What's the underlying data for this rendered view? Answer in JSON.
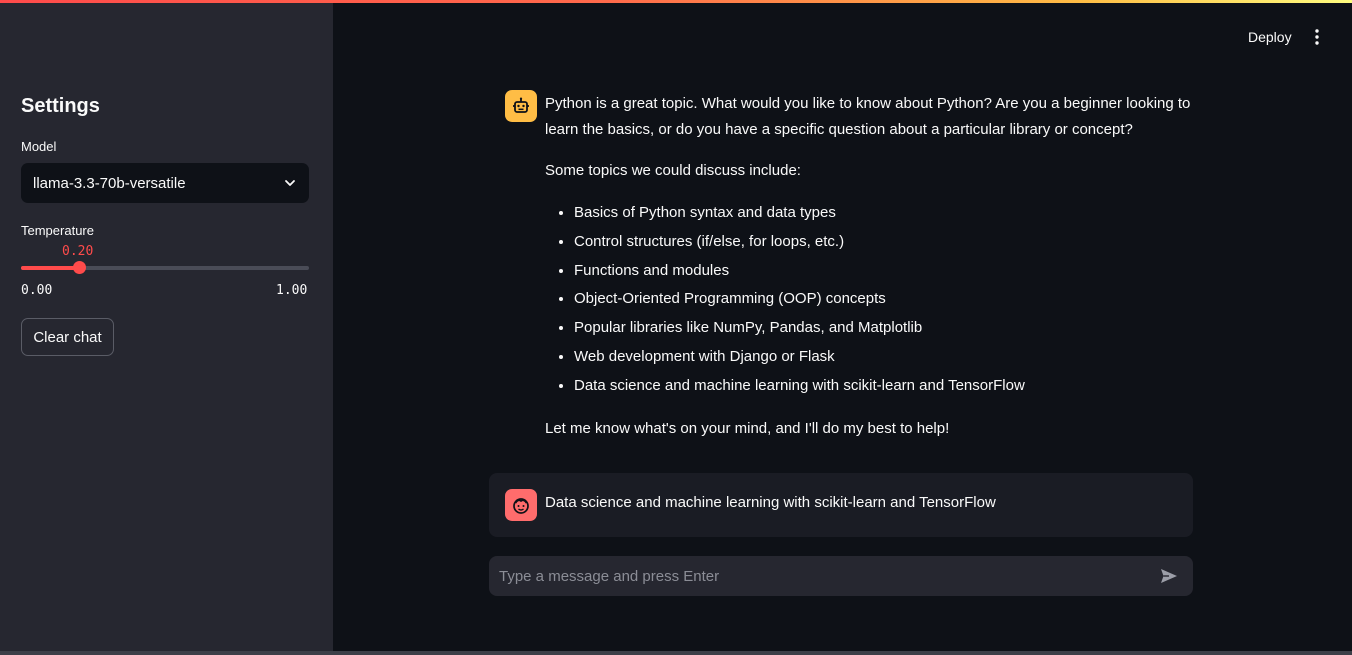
{
  "sidebar": {
    "title": "Settings",
    "model_label": "Model",
    "model_selected": "llama-3.3-70b-versatile",
    "temperature_label": "Temperature",
    "temperature_value": "0.20",
    "temperature_fraction": 0.2,
    "temperature_min": "0.00",
    "temperature_max": "1.00",
    "clear_button": "Clear chat"
  },
  "header": {
    "deploy_label": "Deploy"
  },
  "chat": {
    "assistant": {
      "intro": "Python is a great topic. What would you like to know about Python? Are you a beginner looking to learn the basics, or do you have a specific question about a particular library or concept?",
      "topics_heading": "Some topics we could discuss include:",
      "topics": [
        "Basics of Python syntax and data types",
        "Control structures (if/else, for loops, etc.)",
        "Functions and modules",
        "Object-Oriented Programming (OOP) concepts",
        "Popular libraries like NumPy, Pandas, and Matplotlib",
        "Web development with Django or Flask",
        "Data science and machine learning with scikit-learn and TensorFlow"
      ],
      "closing": "Let me know what's on your mind, and I'll do my best to help!"
    },
    "user": {
      "text": "Data science and machine learning with scikit-learn and TensorFlow"
    },
    "input_placeholder": "Type a message and press Enter"
  },
  "colors": {
    "accent": "#ff4b4b",
    "sidebar_bg": "#262730",
    "main_bg": "#0e1117",
    "bot_avatar": "#ffbd45",
    "user_avatar": "#ff6c6c"
  },
  "icons": {
    "bot_avatar": "robot-icon",
    "user_avatar": "user-face-icon",
    "select": "chevron-down-icon",
    "menu": "vertical-dots-icon",
    "send": "send-icon"
  }
}
